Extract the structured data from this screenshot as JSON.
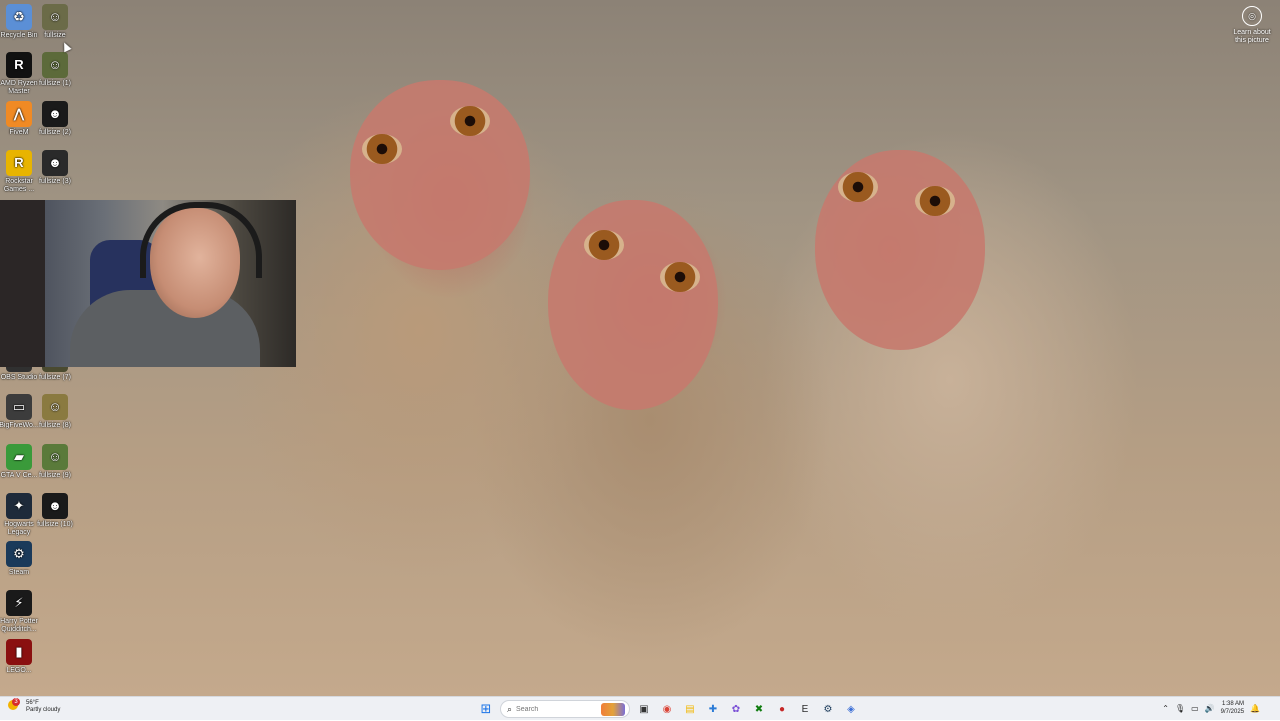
{
  "desktop": {
    "icons": [
      {
        "label": "Recycle Bin",
        "glyph": "♻",
        "color": "#5b8fd6",
        "icon": "recycle-bin-icon"
      },
      {
        "label": "fullsize",
        "glyph": "☺",
        "color": "#6b6b48",
        "icon": "image-icon"
      },
      {
        "label": "AMD Ryzen Master",
        "glyph": "R",
        "color": "#111111",
        "icon": "amd-icon"
      },
      {
        "label": "fullsize (1)",
        "glyph": "☺",
        "color": "#5c6a3a",
        "icon": "image-icon"
      },
      {
        "label": "FiveM",
        "glyph": "⋀",
        "color": "#f08a24",
        "icon": "fivem-icon"
      },
      {
        "label": "fullsize (2)",
        "glyph": "☻",
        "color": "#1a1a1a",
        "icon": "image-icon"
      },
      {
        "label": "Rockstar Games ...",
        "glyph": "R",
        "color": "#e8b400",
        "icon": "rockstar-icon"
      },
      {
        "label": "fullsize (3)",
        "glyph": "☻",
        "color": "#2a2a2a",
        "icon": "image-icon"
      },
      {
        "label": "OBS Studio",
        "glyph": "●",
        "color": "#303030",
        "icon": "obs-icon"
      },
      {
        "label": "fullsize (7)",
        "glyph": "☺",
        "color": "#4a4a30",
        "icon": "image-icon"
      },
      {
        "label": "BigFiveWo...",
        "glyph": "▭",
        "color": "#3c3c3c",
        "icon": "app-icon"
      },
      {
        "label": "fullsize (8)",
        "glyph": "☺",
        "color": "#8a7a40",
        "icon": "image-icon"
      },
      {
        "label": "GTA V Ce...",
        "glyph": "▰",
        "color": "#3a9a3a",
        "icon": "app-icon"
      },
      {
        "label": "fullsize (9)",
        "glyph": "☺",
        "color": "#5a7a3a",
        "icon": "image-icon"
      },
      {
        "label": "Hogwarts Legacy",
        "glyph": "✦",
        "color": "#1e2a3a",
        "icon": "hogwarts-icon"
      },
      {
        "label": "fullsize (10)",
        "glyph": "☻",
        "color": "#1a1a1a",
        "icon": "image-icon"
      },
      {
        "label": "Steam",
        "glyph": "⚙",
        "color": "#1b3a5a",
        "icon": "steam-icon"
      },
      {
        "label": "Harry Potter Quidditch...",
        "glyph": "⚡",
        "color": "#1a1a1a",
        "icon": "quidditch-icon"
      },
      {
        "label": "LEGO...",
        "glyph": "▮",
        "color": "#8a1010",
        "icon": "app-icon"
      }
    ]
  },
  "learn": {
    "label": "Learn about this picture",
    "icon": "camera-icon"
  },
  "taskbar": {
    "weather": {
      "temp": "56°F",
      "condition": "Partly cloudy",
      "alert": "3"
    },
    "search": {
      "placeholder": "Search"
    },
    "apps": [
      {
        "name": "start",
        "glyph": "⊞",
        "color": "#1a73e8"
      },
      {
        "name": "task-view",
        "glyph": "▣",
        "color": "#333333"
      },
      {
        "name": "chrome",
        "glyph": "◉",
        "color": "#db4437"
      },
      {
        "name": "file-explorer",
        "glyph": "▤",
        "color": "#f2b705"
      },
      {
        "name": "app-blue",
        "glyph": "✚",
        "color": "#2b7bd6"
      },
      {
        "name": "app-purple",
        "glyph": "✿",
        "color": "#7a4fd6"
      },
      {
        "name": "xbox",
        "glyph": "✖",
        "color": "#107c10"
      },
      {
        "name": "app-red",
        "glyph": "●",
        "color": "#c62828"
      },
      {
        "name": "epic-games",
        "glyph": "E",
        "color": "#2a2a2a"
      },
      {
        "name": "steam",
        "glyph": "⚙",
        "color": "#1b3a5a"
      },
      {
        "name": "app-blue2",
        "glyph": "◈",
        "color": "#3c6fd6"
      }
    ],
    "clock": {
      "time": "1:38 AM",
      "date": "9/7/2025"
    }
  }
}
